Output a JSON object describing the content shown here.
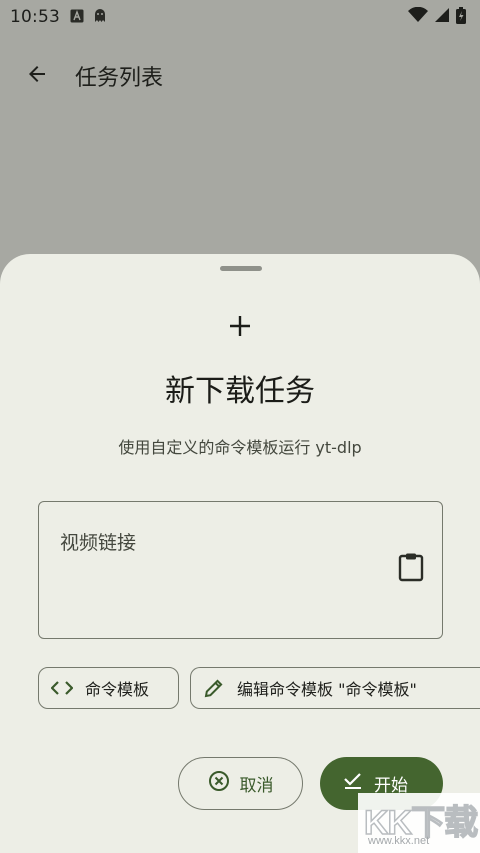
{
  "status_bar": {
    "time": "10:53",
    "left_icons": [
      "a-notification-icon",
      "ghost-app-icon"
    ],
    "right_icons": [
      "wifi-icon",
      "signal-icon",
      "battery-icon"
    ]
  },
  "app_bar": {
    "title": "任务列表",
    "back_icon": "arrow-back-icon"
  },
  "sheet": {
    "header_icon": "add-icon",
    "title": "新下载任务",
    "subtitle": "使用自定义的命令模板运行 yt-dlp",
    "url_field": {
      "placeholder": "视频链接",
      "value": "",
      "trailing_icon": "clipboard-icon"
    },
    "chips": [
      {
        "label": "命令模板",
        "icon": "code-icon"
      },
      {
        "label": "编辑命令模板 \"命令模板\"",
        "icon": "edit-pencil-icon"
      }
    ],
    "cancel_button": {
      "label": "取消",
      "icon": "cancel-circle-icon"
    },
    "start_button": {
      "label": "开始",
      "icon": "check-icon"
    }
  },
  "colors": {
    "scrim_background": "#a7a8a2",
    "sheet_background": "#edeee6",
    "primary": "#44652f",
    "outline": "#75796d"
  },
  "watermark": {
    "main_text": "KK下载",
    "url_text": "www.kkx.net"
  }
}
